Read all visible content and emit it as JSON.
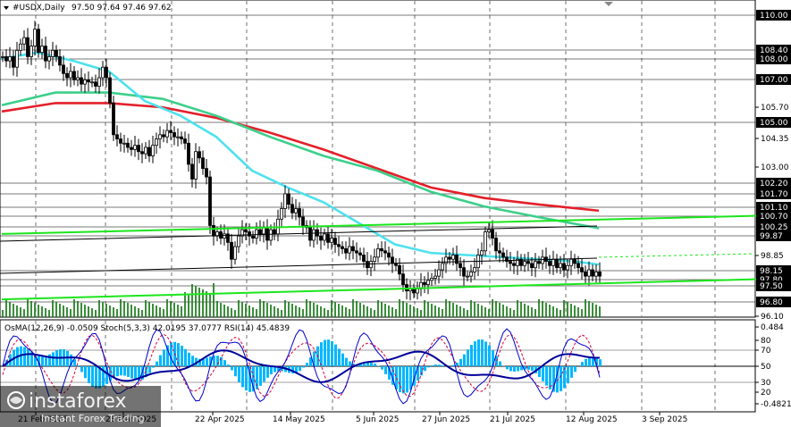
{
  "header": {
    "symbol": "#USDX,Daily",
    "ohlc": "97.50 97.64 97.46 97.62"
  },
  "indicator_header": "OsMA(12,26,9) -0.0509 Stoch(5,3,3) 42.0195 37.0777 RSI(14) 45.4839",
  "watermark": {
    "brand": "instaforex",
    "sub": "Instant Forex Trading"
  },
  "colors": {
    "candle": "#000000",
    "ma_red": "#e3202a",
    "ma_green": "#3ccf8b",
    "ma_cyan": "#4ee1ee",
    "trend_green": "#1be61b",
    "osma_bar": "#00b7ff",
    "indicator_blue": "#0000cc",
    "indicator_red": "#d8003a",
    "volume": "#1a7a1a"
  },
  "chart_data": {
    "type": "line",
    "title": "#USDX,Daily",
    "price_axis_labels": [
      "110.00",
      "108.40",
      "108.00",
      "107.00",
      "105.70",
      "105.00",
      "104.35",
      "103.00",
      "102.20",
      "101.70",
      "101.10",
      "100.70",
      "100.25",
      "99.87",
      "98.85",
      "98.15",
      "97.80",
      "97.50",
      "96.80",
      "96.10"
    ],
    "indicator_axis_labels": [
      "0.484",
      "80",
      "70",
      "50",
      "30",
      "20",
      "-0.4821"
    ],
    "highlighted_labels": [
      "110.00",
      "108.40",
      "108.00",
      "107.00",
      "105.00",
      "102.20",
      "101.70",
      "101.10",
      "100.70",
      "100.25",
      "99.87",
      "98.15",
      "97.80",
      "97.50",
      "96.80"
    ],
    "date_labels": [
      "21 Feb 2025",
      "28 Mar 2025",
      "22 Apr 2025",
      "14 May 2025",
      "5 Jun 2025",
      "27 Jun 2025",
      "21 Jul 2025",
      "12 Aug 2025",
      "3 Sep 2025"
    ],
    "ylim": [
      95.7,
      110.6
    ],
    "bars": [
      {
        "d": 0,
        "c": 108.0
      },
      {
        "d": 4,
        "c": 107.8
      },
      {
        "d": 8,
        "c": 108.0
      },
      {
        "d": 12,
        "c": 107.5
      },
      {
        "d": 16,
        "c": 108.3
      },
      {
        "d": 20,
        "c": 108.6
      },
      {
        "d": 24,
        "c": 108.9
      },
      {
        "d": 28,
        "c": 108.0
      },
      {
        "d": 32,
        "c": 108.5
      },
      {
        "d": 36,
        "c": 109.3
      },
      {
        "d": 40,
        "c": 108.2
      },
      {
        "d": 44,
        "c": 108.5
      },
      {
        "d": 48,
        "c": 107.8
      },
      {
        "d": 52,
        "c": 108.0
      },
      {
        "d": 56,
        "c": 108.3
      },
      {
        "d": 60,
        "c": 108.0
      },
      {
        "d": 64,
        "c": 107.6
      },
      {
        "d": 68,
        "c": 107.2
      },
      {
        "d": 72,
        "c": 107.0
      },
      {
        "d": 76,
        "c": 107.3
      },
      {
        "d": 80,
        "c": 106.9
      },
      {
        "d": 84,
        "c": 107.0
      },
      {
        "d": 88,
        "c": 106.7
      },
      {
        "d": 92,
        "c": 106.9
      },
      {
        "d": 96,
        "c": 106.8
      },
      {
        "d": 100,
        "c": 106.8
      },
      {
        "d": 104,
        "c": 106.6
      },
      {
        "d": 108,
        "c": 107.0
      },
      {
        "d": 112,
        "c": 107.5
      },
      {
        "d": 116,
        "c": 107.0
      },
      {
        "d": 120,
        "c": 105.8
      },
      {
        "d": 124,
        "c": 104.3
      },
      {
        "d": 128,
        "c": 104.1
      },
      {
        "d": 132,
        "c": 103.9
      },
      {
        "d": 136,
        "c": 103.9
      },
      {
        "d": 140,
        "c": 103.7
      },
      {
        "d": 144,
        "c": 103.6
      },
      {
        "d": 148,
        "c": 103.8
      },
      {
        "d": 152,
        "c": 103.5
      },
      {
        "d": 156,
        "c": 103.4
      },
      {
        "d": 160,
        "c": 103.7
      },
      {
        "d": 164,
        "c": 103.3
      },
      {
        "d": 168,
        "c": 103.8
      },
      {
        "d": 172,
        "c": 104.1
      },
      {
        "d": 176,
        "c": 104.3
      },
      {
        "d": 180,
        "c": 104.2
      },
      {
        "d": 184,
        "c": 104.5
      },
      {
        "d": 188,
        "c": 104.4
      },
      {
        "d": 192,
        "c": 104.2
      },
      {
        "d": 196,
        "c": 104.2
      },
      {
        "d": 200,
        "c": 104.1
      },
      {
        "d": 204,
        "c": 103.9
      },
      {
        "d": 208,
        "c": 102.9
      },
      {
        "d": 212,
        "c": 102.2
      },
      {
        "d": 216,
        "c": 103.5
      },
      {
        "d": 220,
        "c": 103.2
      },
      {
        "d": 224,
        "c": 102.7
      },
      {
        "d": 228,
        "c": 102.3
      },
      {
        "d": 232,
        "c": 100.0
      },
      {
        "d": 236,
        "c": 99.5
      },
      {
        "d": 240,
        "c": 99.7
      },
      {
        "d": 244,
        "c": 99.4
      },
      {
        "d": 248,
        "c": 99.6
      },
      {
        "d": 252,
        "c": 99.2
      },
      {
        "d": 256,
        "c": 98.4
      },
      {
        "d": 260,
        "c": 99.0
      },
      {
        "d": 264,
        "c": 99.5
      },
      {
        "d": 268,
        "c": 99.8
      },
      {
        "d": 272,
        "c": 99.7
      },
      {
        "d": 276,
        "c": 99.5
      },
      {
        "d": 280,
        "c": 99.4
      },
      {
        "d": 284,
        "c": 99.8
      },
      {
        "d": 288,
        "c": 99.6
      },
      {
        "d": 292,
        "c": 99.9
      },
      {
        "d": 296,
        "c": 99.3
      },
      {
        "d": 300,
        "c": 99.8
      },
      {
        "d": 304,
        "c": 99.6
      },
      {
        "d": 308,
        "c": 100.3
      },
      {
        "d": 312,
        "c": 100.8
      },
      {
        "d": 316,
        "c": 101.5
      },
      {
        "d": 320,
        "c": 101.0
      },
      {
        "d": 324,
        "c": 100.6
      },
      {
        "d": 328,
        "c": 100.8
      },
      {
        "d": 332,
        "c": 100.4
      },
      {
        "d": 336,
        "c": 100.0
      },
      {
        "d": 340,
        "c": 99.9
      },
      {
        "d": 344,
        "c": 99.3
      },
      {
        "d": 348,
        "c": 99.8
      },
      {
        "d": 352,
        "c": 99.5
      },
      {
        "d": 356,
        "c": 99.3
      },
      {
        "d": 360,
        "c": 99.6
      },
      {
        "d": 364,
        "c": 99.2
      },
      {
        "d": 368,
        "c": 99.4
      },
      {
        "d": 372,
        "c": 99.1
      },
      {
        "d": 376,
        "c": 99.0
      },
      {
        "d": 380,
        "c": 98.9
      },
      {
        "d": 384,
        "c": 98.7
      },
      {
        "d": 388,
        "c": 99.0
      },
      {
        "d": 392,
        "c": 98.8
      },
      {
        "d": 396,
        "c": 98.7
      },
      {
        "d": 400,
        "c": 98.6
      },
      {
        "d": 404,
        "c": 98.3
      },
      {
        "d": 408,
        "c": 98.0
      },
      {
        "d": 412,
        "c": 98.3
      },
      {
        "d": 416,
        "c": 98.5
      },
      {
        "d": 420,
        "c": 98.9
      },
      {
        "d": 424,
        "c": 98.8
      },
      {
        "d": 428,
        "c": 98.7
      },
      {
        "d": 432,
        "c": 98.5
      },
      {
        "d": 436,
        "c": 98.2
      },
      {
        "d": 440,
        "c": 98.1
      },
      {
        "d": 444,
        "c": 97.7
      },
      {
        "d": 448,
        "c": 97.2
      },
      {
        "d": 452,
        "c": 96.9
      },
      {
        "d": 456,
        "c": 97.0
      },
      {
        "d": 460,
        "c": 96.8
      },
      {
        "d": 464,
        "c": 97.0
      },
      {
        "d": 468,
        "c": 97.3
      },
      {
        "d": 472,
        "c": 97.2
      },
      {
        "d": 476,
        "c": 97.4
      },
      {
        "d": 480,
        "c": 97.5
      },
      {
        "d": 484,
        "c": 97.6
      },
      {
        "d": 488,
        "c": 97.9
      },
      {
        "d": 492,
        "c": 98.2
      },
      {
        "d": 496,
        "c": 98.5
      },
      {
        "d": 500,
        "c": 98.4
      },
      {
        "d": 504,
        "c": 98.6
      },
      {
        "d": 508,
        "c": 98.2
      },
      {
        "d": 512,
        "c": 98.0
      },
      {
        "d": 516,
        "c": 97.6
      },
      {
        "d": 520,
        "c": 97.6
      },
      {
        "d": 524,
        "c": 97.8
      },
      {
        "d": 528,
        "c": 98.0
      },
      {
        "d": 532,
        "c": 98.6
      },
      {
        "d": 536,
        "c": 98.8
      },
      {
        "d": 540,
        "c": 99.7
      },
      {
        "d": 544,
        "c": 99.8
      },
      {
        "d": 548,
        "c": 99.4
      },
      {
        "d": 552,
        "c": 98.8
      },
      {
        "d": 556,
        "c": 98.7
      },
      {
        "d": 560,
        "c": 98.5
      },
      {
        "d": 564,
        "c": 98.3
      },
      {
        "d": 568,
        "c": 98.2
      },
      {
        "d": 572,
        "c": 98.1
      },
      {
        "d": 576,
        "c": 98.4
      },
      {
        "d": 580,
        "c": 98.1
      },
      {
        "d": 584,
        "c": 98.3
      },
      {
        "d": 588,
        "c": 98.2
      },
      {
        "d": 592,
        "c": 98.0
      },
      {
        "d": 596,
        "c": 98.3
      },
      {
        "d": 600,
        "c": 98.2
      },
      {
        "d": 604,
        "c": 98.5
      },
      {
        "d": 608,
        "c": 98.3
      },
      {
        "d": 612,
        "c": 98.1
      },
      {
        "d": 616,
        "c": 98.4
      },
      {
        "d": 620,
        "c": 98.0
      },
      {
        "d": 624,
        "c": 98.2
      },
      {
        "d": 628,
        "c": 97.9
      },
      {
        "d": 632,
        "c": 98.1
      },
      {
        "d": 636,
        "c": 98.4
      },
      {
        "d": 640,
        "c": 98.2
      },
      {
        "d": 644,
        "c": 98.0
      },
      {
        "d": 648,
        "c": 97.8
      },
      {
        "d": 652,
        "c": 97.6
      },
      {
        "d": 656,
        "c": 97.9
      },
      {
        "d": 660,
        "c": 97.6
      },
      {
        "d": 664,
        "c": 97.8
      },
      {
        "d": 668,
        "c": 97.6
      }
    ],
    "series": [
      {
        "name": "",
        "color": "#e3202a",
        "points": [
          [
            0,
            105.4
          ],
          [
            60,
            105.8
          ],
          [
            120,
            105.8
          ],
          [
            180,
            105.6
          ],
          [
            240,
            105.1
          ],
          [
            300,
            104.4
          ],
          [
            360,
            103.6
          ],
          [
            420,
            102.7
          ],
          [
            480,
            101.8
          ],
          [
            540,
            101.3
          ],
          [
            600,
            101.0
          ],
          [
            668,
            100.7
          ]
        ]
      },
      {
        "name": "",
        "color": "#3ccf8b",
        "points": [
          [
            0,
            105.7
          ],
          [
            60,
            106.3
          ],
          [
            120,
            106.3
          ],
          [
            180,
            106.0
          ],
          [
            240,
            105.2
          ],
          [
            300,
            104.2
          ],
          [
            360,
            103.3
          ],
          [
            420,
            102.6
          ],
          [
            480,
            101.6
          ],
          [
            540,
            100.9
          ],
          [
            600,
            100.4
          ],
          [
            668,
            99.87
          ]
        ]
      },
      {
        "name": "",
        "color": "#4ee1ee",
        "points": [
          [
            0,
            107.9
          ],
          [
            40,
            108.2
          ],
          [
            80,
            107.8
          ],
          [
            120,
            107.3
          ],
          [
            160,
            105.9
          ],
          [
            200,
            105.2
          ],
          [
            240,
            104.2
          ],
          [
            280,
            102.6
          ],
          [
            320,
            101.8
          ],
          [
            360,
            101.1
          ],
          [
            400,
            100.1
          ],
          [
            440,
            99.1
          ],
          [
            480,
            98.7
          ],
          [
            520,
            98.6
          ],
          [
            560,
            98.5
          ],
          [
            600,
            98.4
          ],
          [
            640,
            98.3
          ],
          [
            668,
            98.15
          ]
        ]
      },
      {
        "name": "",
        "color": "#1be61b",
        "points": [
          [
            0,
            99.6
          ],
          [
            885,
            100.5
          ]
        ]
      },
      {
        "name": "",
        "color": "#1be61b",
        "points": [
          [
            0,
            96.5
          ],
          [
            885,
            97.5
          ]
        ]
      }
    ]
  }
}
